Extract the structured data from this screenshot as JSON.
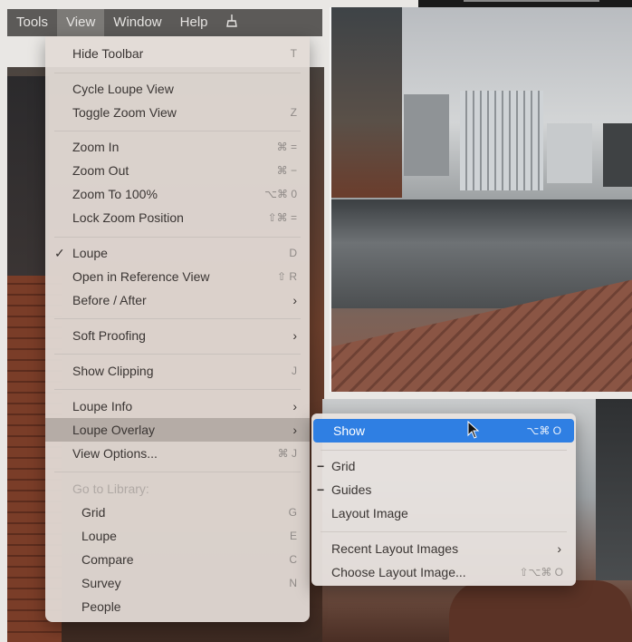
{
  "menubar": {
    "items": [
      {
        "label": "Tools"
      },
      {
        "label": "View"
      },
      {
        "label": "Window"
      },
      {
        "label": "Help"
      }
    ],
    "extra_icon": "broom-icon"
  },
  "view_menu": {
    "items": [
      {
        "label": "Hide Toolbar",
        "shortcut": "T"
      },
      {
        "label": "Cycle Loupe View",
        "shortcut": ""
      },
      {
        "label": "Toggle Zoom View",
        "shortcut": "Z"
      },
      {
        "label": "Zoom In",
        "shortcut": "⌘ ="
      },
      {
        "label": "Zoom Out",
        "shortcut": "⌘ −"
      },
      {
        "label": "Zoom To 100%",
        "shortcut": "⌥⌘ 0"
      },
      {
        "label": "Lock Zoom Position",
        "shortcut": "⇧⌘ ="
      },
      {
        "label": "Loupe",
        "shortcut": "D",
        "checked": "✓"
      },
      {
        "label": "Open in Reference View",
        "shortcut": "⇧ R"
      },
      {
        "label": "Before / After",
        "arrow": "›"
      },
      {
        "label": "Soft Proofing",
        "arrow": "›"
      },
      {
        "label": "Show Clipping",
        "shortcut": "J"
      },
      {
        "label": "Loupe Info",
        "arrow": "›"
      },
      {
        "label": "Loupe Overlay",
        "arrow": "›"
      },
      {
        "label": "View Options...",
        "shortcut": "⌘ J"
      },
      {
        "label": "Go to Library:"
      },
      {
        "label": "Grid",
        "shortcut": "G"
      },
      {
        "label": "Loupe",
        "shortcut": "E"
      },
      {
        "label": "Compare",
        "shortcut": "C"
      },
      {
        "label": "Survey",
        "shortcut": "N"
      },
      {
        "label": "People",
        "shortcut": ""
      }
    ]
  },
  "overlay_submenu": {
    "items": [
      {
        "label": "Show",
        "shortcut": "⌥⌘ O"
      },
      {
        "label": "Grid",
        "mark": "−"
      },
      {
        "label": "Guides",
        "mark": "−"
      },
      {
        "label": "Layout Image"
      },
      {
        "label": "Recent Layout Images",
        "arrow": "›"
      },
      {
        "label": "Choose Layout Image...",
        "shortcut": "⇧⌥⌘ O"
      }
    ]
  },
  "colors": {
    "highlight_blue": "#2f7fe3",
    "menu_bg": "#e2dbd6",
    "menubar_bg": "#5c5a58"
  }
}
